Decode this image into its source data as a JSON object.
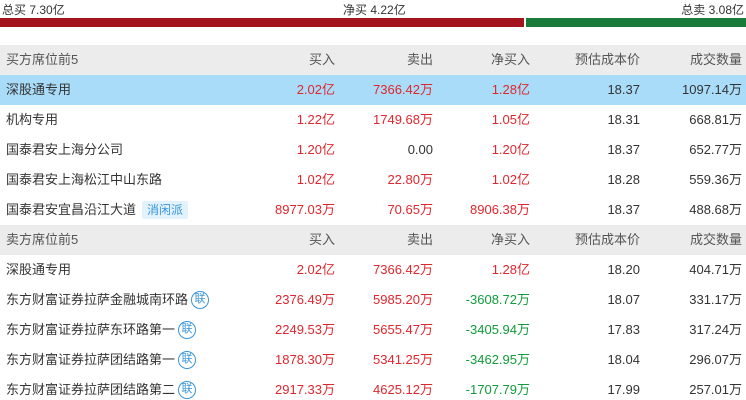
{
  "summary": {
    "total_buy": "总买 7.30亿",
    "net_buy": "净买 4.22亿",
    "total_sell": "总卖 3.08亿"
  },
  "bar": {
    "buy_fraction": 0.703,
    "buy_color": "#a3141c",
    "sell_color": "#1a7a37"
  },
  "buy_section": {
    "headers": [
      "买方席位前5",
      "买入",
      "卖出",
      "净买入",
      "预估成本价",
      "成交数量"
    ],
    "rows": [
      {
        "name": "深股通专用",
        "buy": "2.02亿",
        "sell": "7366.42万",
        "net": "1.28亿",
        "cost": "18.37",
        "volume": "1097.14万",
        "tag": "",
        "lian": ""
      },
      {
        "name": "机构专用",
        "buy": "1.22亿",
        "sell": "1749.68万",
        "net": "1.05亿",
        "cost": "18.31",
        "volume": "668.81万",
        "tag": "",
        "lian": ""
      },
      {
        "name": "国泰君安上海分公司",
        "buy": "1.20亿",
        "sell": "0.00",
        "net": "1.20亿",
        "cost": "18.37",
        "volume": "652.77万",
        "tag": "",
        "lian": ""
      },
      {
        "name": "国泰君安上海松江中山东路",
        "buy": "1.02亿",
        "sell": "22.80万",
        "net": "1.02亿",
        "cost": "18.28",
        "volume": "559.36万",
        "tag": "",
        "lian": ""
      },
      {
        "name": "国泰君安宜昌沿江大道",
        "buy": "8977.03万",
        "sell": "70.65万",
        "net": "8906.38万",
        "cost": "18.37",
        "volume": "488.68万",
        "tag": "消闲派",
        "lian": ""
      }
    ]
  },
  "sell_section": {
    "headers": [
      "卖方席位前5",
      "买入",
      "卖出",
      "净买入",
      "预估成本价",
      "成交数量"
    ],
    "rows": [
      {
        "name": "深股通专用",
        "buy": "2.02亿",
        "sell": "7366.42万",
        "net": "1.28亿",
        "cost": "18.20",
        "volume": "404.71万",
        "tag": "",
        "lian": ""
      },
      {
        "name": "东方财富证券拉萨金融城南环路",
        "buy": "2376.49万",
        "sell": "5985.20万",
        "net": "-3608.72万",
        "cost": "18.07",
        "volume": "331.17万",
        "tag": "",
        "lian": "联"
      },
      {
        "name": "东方财富证券拉萨东环路第一",
        "buy": "2249.53万",
        "sell": "5655.47万",
        "net": "-3405.94万",
        "cost": "17.83",
        "volume": "317.24万",
        "tag": "",
        "lian": "联"
      },
      {
        "name": "东方财富证券拉萨团结路第一",
        "buy": "1878.30万",
        "sell": "5341.25万",
        "net": "-3462.95万",
        "cost": "18.04",
        "volume": "296.07万",
        "tag": "",
        "lian": "联"
      },
      {
        "name": "东方财富证券拉萨团结路第二",
        "buy": "2917.33万",
        "sell": "4625.12万",
        "net": "-1707.79万",
        "cost": "17.99",
        "volume": "257.01万",
        "tag": "",
        "lian": "联"
      }
    ]
  }
}
